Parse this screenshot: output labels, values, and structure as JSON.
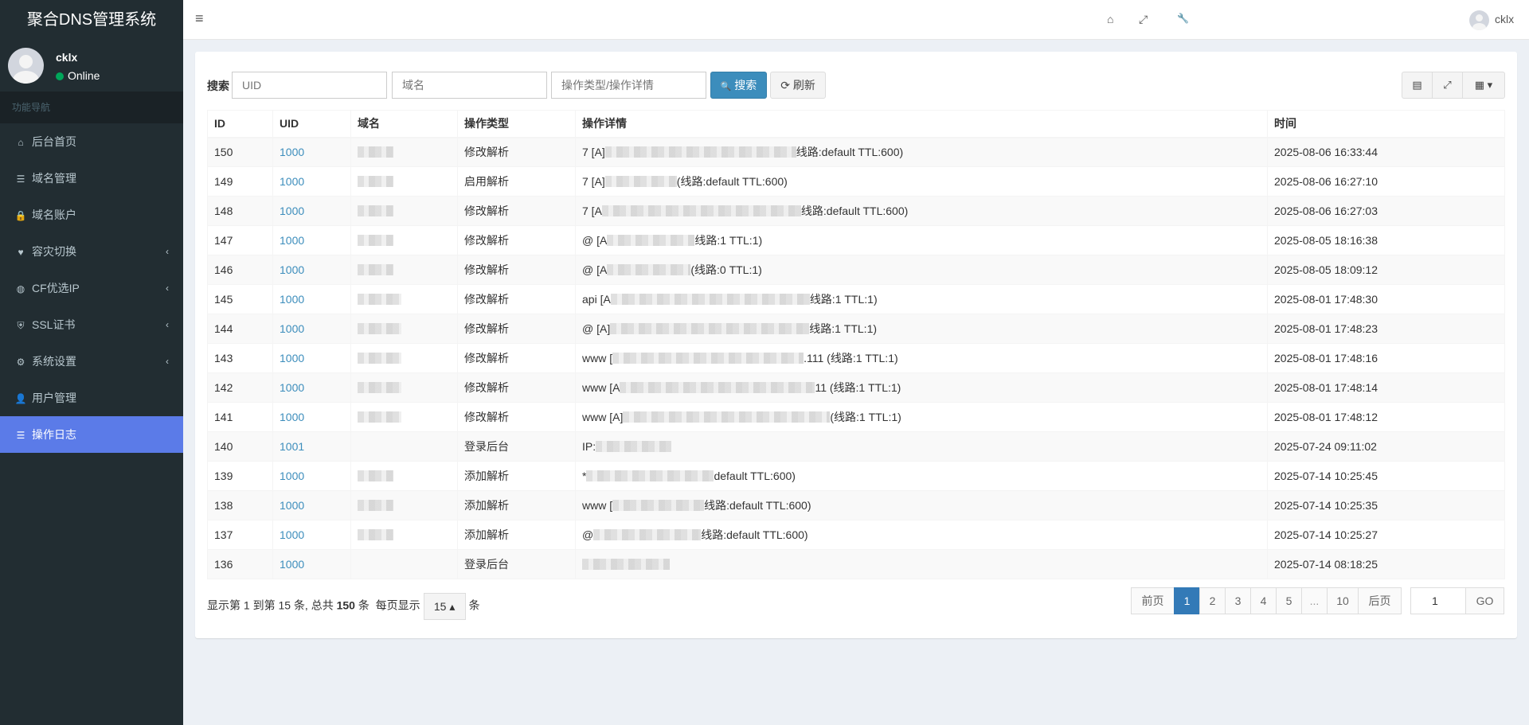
{
  "app": {
    "title": "聚合DNS管理系统"
  },
  "user": {
    "name": "cklx",
    "status": "Online"
  },
  "sidebar": {
    "header": "功能导航",
    "items": [
      {
        "label": "后台首页",
        "icon": "home-icon",
        "glyph": "⌂",
        "arrow": ""
      },
      {
        "label": "域名管理",
        "icon": "list-icon",
        "glyph": "☰",
        "arrow": ""
      },
      {
        "label": "域名账户",
        "icon": "lock-icon",
        "glyph": "🔒",
        "arrow": ""
      },
      {
        "label": "容灾切换",
        "icon": "heartbeat-icon",
        "glyph": "♥",
        "arrow": "‹"
      },
      {
        "label": "CF优选IP",
        "icon": "globe-icon",
        "glyph": "◍",
        "arrow": "‹"
      },
      {
        "label": "SSL证书",
        "icon": "shield-icon",
        "glyph": "⛨",
        "arrow": "‹"
      },
      {
        "label": "系统设置",
        "icon": "cogs-icon",
        "glyph": "⚙",
        "arrow": "‹"
      },
      {
        "label": "用户管理",
        "icon": "user-icon",
        "glyph": "👤",
        "arrow": ""
      },
      {
        "label": "操作日志",
        "icon": "list-icon",
        "glyph": "☰",
        "arrow": ""
      }
    ]
  },
  "navbar": {
    "username": "cklx",
    "toggle_glyph": "≡",
    "home_glyph": "⌂",
    "fullscreen_glyph": "⤢",
    "wrench_glyph": "🔧"
  },
  "search": {
    "label": "搜索",
    "uid_placeholder": "UID",
    "domain_placeholder": "域名",
    "action_placeholder": "操作类型/操作详情",
    "search_button": "搜索",
    "search_glyph": "🔍",
    "refresh_button": "刷新",
    "refresh_glyph": "⟳"
  },
  "toolbar": {
    "print_glyph": "▤",
    "fullscreen_glyph": "⤢",
    "columns_glyph": "▦ ▾"
  },
  "table": {
    "columns": [
      "ID",
      "UID",
      "域名",
      "操作类型",
      "操作详情",
      "时间"
    ],
    "rows": [
      {
        "id": "150",
        "uid": "1000",
        "type": "修改解析",
        "detail_pre": "7 [A]",
        "detail_post": "线路:default TTL:600)",
        "blur": 240,
        "time": "2025-08-06 16:33:44"
      },
      {
        "id": "149",
        "uid": "1000",
        "type": "启用解析",
        "detail_pre": "7 [A]",
        "detail_post": "(线路:default TTL:600)",
        "blur": 90,
        "time": "2025-08-06 16:27:10"
      },
      {
        "id": "148",
        "uid": "1000",
        "type": "修改解析",
        "detail_pre": "7 [A",
        "detail_post": "线路:default TTL:600)",
        "blur": 250,
        "time": "2025-08-06 16:27:03"
      },
      {
        "id": "147",
        "uid": "1000",
        "type": "修改解析",
        "detail_pre": "@ [A",
        "detail_post": "线路:1 TTL:1)",
        "blur": 110,
        "time": "2025-08-05 18:16:38"
      },
      {
        "id": "146",
        "uid": "1000",
        "type": "修改解析",
        "detail_pre": "@ [A",
        "detail_post": "(线路:0 TTL:1)",
        "blur": 105,
        "time": "2025-08-05 18:09:12"
      },
      {
        "id": "145",
        "uid": "1000",
        "type": "修改解析",
        "detail_pre": "api [A",
        "detail_post": "线路:1 TTL:1)",
        "blur": 250,
        "time": "2025-08-01 17:48:30"
      },
      {
        "id": "144",
        "uid": "1000",
        "type": "修改解析",
        "detail_pre": "@ [A]",
        "detail_post": "线路:1 TTL:1)",
        "blur": 250,
        "time": "2025-08-01 17:48:23"
      },
      {
        "id": "143",
        "uid": "1000",
        "type": "修改解析",
        "detail_pre": "www [",
        "detail_post": ".111 (线路:1 TTL:1)",
        "blur": 240,
        "time": "2025-08-01 17:48:16"
      },
      {
        "id": "142",
        "uid": "1000",
        "type": "修改解析",
        "detail_pre": "www [A",
        "detail_post": "11 (线路:1 TTL:1)",
        "blur": 245,
        "time": "2025-08-01 17:48:14"
      },
      {
        "id": "141",
        "uid": "1000",
        "type": "修改解析",
        "detail_pre": "www [A]",
        "detail_post": "(线路:1 TTL:1)",
        "blur": 260,
        "time": "2025-08-01 17:48:12"
      },
      {
        "id": "140",
        "uid": "1001",
        "type": "登录后台",
        "detail_pre": "IP:",
        "detail_post": "",
        "blur": 95,
        "time": "2025-07-24 09:11:02"
      },
      {
        "id": "139",
        "uid": "1000",
        "type": "添加解析",
        "detail_pre": "*",
        "detail_post": "default TTL:600)",
        "blur": 160,
        "time": "2025-07-14 10:25:45"
      },
      {
        "id": "138",
        "uid": "1000",
        "type": "添加解析",
        "detail_pre": "www [",
        "detail_post": "线路:default TTL:600)",
        "blur": 115,
        "time": "2025-07-14 10:25:35"
      },
      {
        "id": "137",
        "uid": "1000",
        "type": "添加解析",
        "detail_pre": "@",
        "detail_post": "线路:default TTL:600)",
        "blur": 135,
        "time": "2025-07-14 10:25:27"
      },
      {
        "id": "136",
        "uid": "1000",
        "type": "登录后台",
        "detail_pre": "",
        "detail_post": "",
        "blur": 110,
        "time": "2025-07-14 08:18:25"
      }
    ]
  },
  "footer": {
    "prefix": "显示第",
    "from": "1",
    "mid1": "到第",
    "to": "15",
    "mid2": "条, 总共",
    "total": "150",
    "mid3": "条",
    "per_page_label": "每页显示",
    "per_page": "15 ▴",
    "suffix": "条"
  },
  "pagination": {
    "prev": "前页",
    "pages": [
      "1",
      "2",
      "3",
      "4",
      "5",
      "...",
      "10"
    ],
    "next": "后页",
    "goto_value": "1",
    "go": "GO"
  }
}
